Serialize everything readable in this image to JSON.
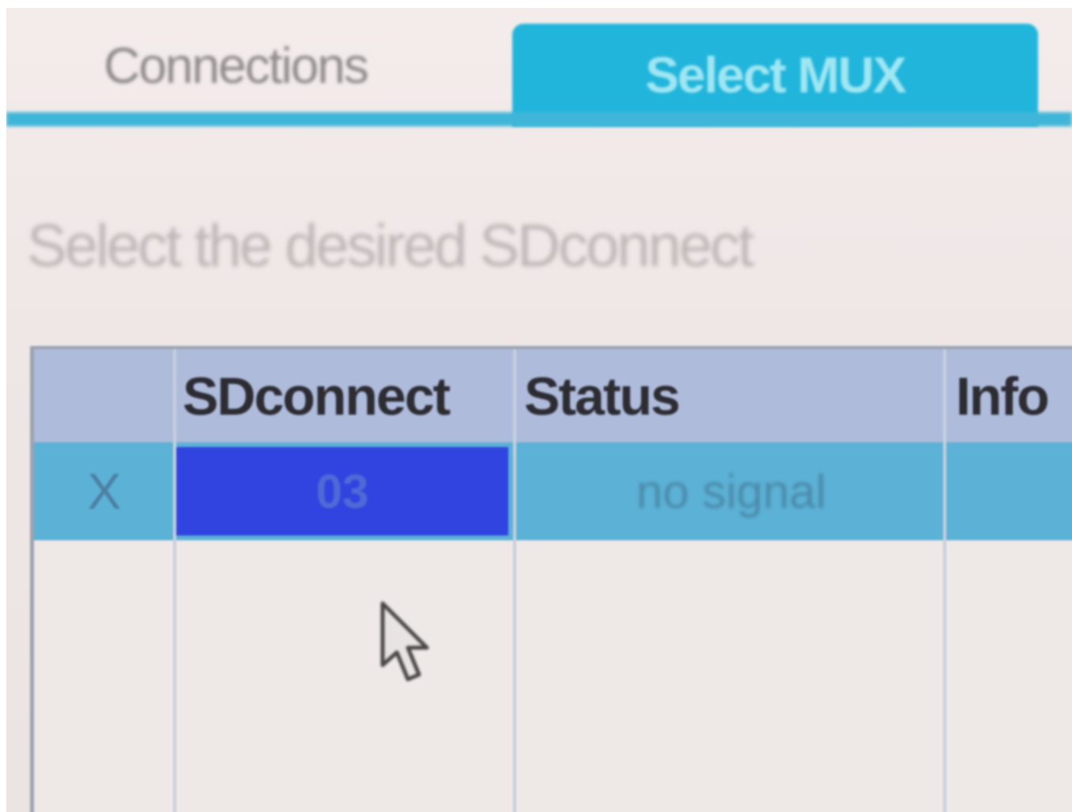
{
  "tabs": [
    {
      "label": "Connections",
      "active": false
    },
    {
      "label": "Select MUX",
      "active": true
    }
  ],
  "instruction": "Select the desired SDconnect",
  "table": {
    "columns": [
      "",
      "SDconnect",
      "Status",
      "Info"
    ],
    "rows": [
      {
        "marker": "X",
        "sdconnect": "03",
        "status": "no signal",
        "info": ""
      }
    ]
  },
  "colors": {
    "active_tab": "#22b5dc",
    "selected_row": "#5cb1d6",
    "selected_cell": "#3144e0",
    "header": "#aebbdb"
  },
  "icons": {
    "cursor": "mouse-pointer-icon"
  }
}
